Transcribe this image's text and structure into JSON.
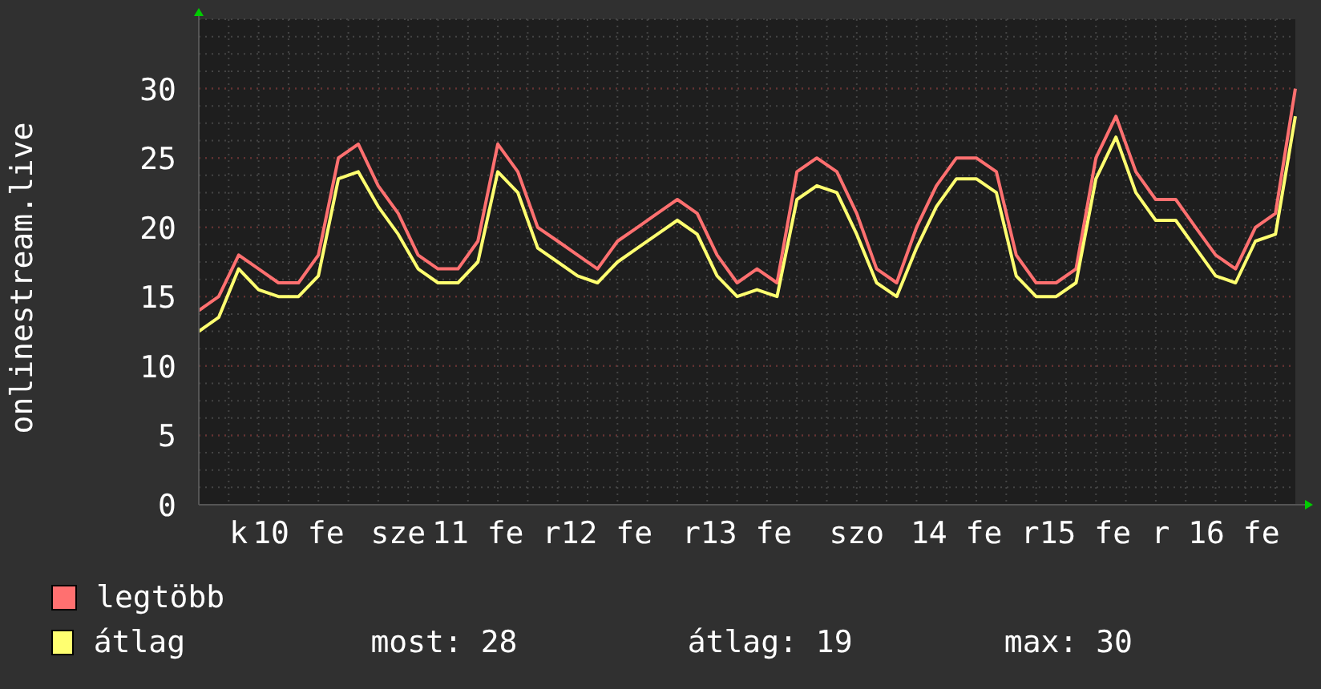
{
  "graph": {
    "chart_data": {
      "type": "line",
      "grid": true,
      "ylabel": "onlinestream.live",
      "ylim": [
        0,
        35
      ],
      "yticks": [
        0,
        5,
        10,
        15,
        20,
        25,
        30
      ],
      "categories": [
        null,
        null,
        "k",
        null,
        null,
        "10 fe",
        null,
        null,
        null,
        null,
        "sze",
        null,
        null,
        null,
        "11 fe",
        null,
        null,
        null,
        null,
        null,
        "r12 fe",
        null,
        null,
        null,
        null,
        null,
        null,
        "r13 fe",
        null,
        null,
        null,
        null,
        null,
        "szo",
        null,
        null,
        null,
        null,
        "14 fe",
        null,
        null,
        null,
        null,
        null,
        "r15 fe",
        null,
        null,
        null,
        null,
        null,
        null,
        "r 16 fe",
        null,
        null,
        null,
        null
      ],
      "series": [
        {
          "name": "legtöbb",
          "color": "#ff7070",
          "values": [
            14,
            15,
            18,
            17,
            16,
            16,
            18,
            25,
            26,
            23,
            21,
            18,
            17,
            17,
            19,
            26,
            24,
            20,
            19,
            18,
            17,
            19,
            20,
            21,
            22,
            21,
            18,
            16,
            17,
            16,
            24,
            25,
            24,
            21,
            17,
            16,
            20,
            23,
            25,
            25,
            24,
            18,
            16,
            16,
            17,
            25,
            28,
            24,
            22,
            22,
            20,
            18,
            17,
            20,
            21,
            30
          ]
        },
        {
          "name": "átlag",
          "color": "#ffff70",
          "values": [
            12.5,
            13.5,
            17,
            15.5,
            15,
            15,
            16.5,
            23.5,
            24,
            21.5,
            19.5,
            17,
            16,
            16,
            17.5,
            24,
            22.5,
            18.5,
            17.5,
            16.5,
            16,
            17.5,
            18.5,
            19.5,
            20.5,
            19.5,
            16.5,
            15,
            15.5,
            15,
            22,
            23,
            22.5,
            19.5,
            16,
            15,
            18.5,
            21.5,
            23.5,
            23.5,
            22.5,
            16.5,
            15,
            15,
            16,
            23.5,
            26.5,
            22.5,
            20.5,
            20.5,
            18.5,
            16.5,
            16,
            19,
            19.5,
            28
          ]
        }
      ]
    }
  },
  "stats": [
    {
      "text": "most: 28"
    },
    {
      "text": "átlag: 19"
    },
    {
      "text": "max: 30"
    }
  ]
}
